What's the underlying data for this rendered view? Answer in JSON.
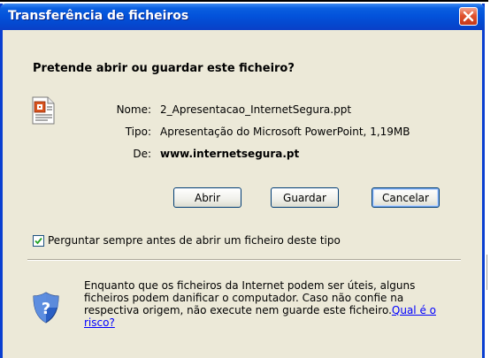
{
  "window": {
    "title": "Transferência de ficheiros",
    "close_icon": "close-icon"
  },
  "dialog": {
    "question": "Pretende abrir ou guardar este ficheiro?",
    "file_icon": "powerpoint-file-icon",
    "info": {
      "name_label": "Nome:",
      "name_value": "2_Apresentacao_InternetSegura.ppt",
      "type_label": "Tipo:",
      "type_value": "Apresentação do Microsoft PowerPoint, 1,19MB",
      "from_label": "De:",
      "from_value": "www.internetsegura.pt"
    },
    "buttons": {
      "open": "Abrir",
      "save": "Guardar",
      "cancel": "Cancelar"
    },
    "checkbox": {
      "label": "Perguntar sempre antes de abrir um ficheiro deste tipo",
      "checked": true
    },
    "warning": {
      "icon": "security-shield-icon",
      "text": "Enquanto que os ficheiros da Internet podem ser úteis, alguns ficheiros podem danificar o computador. Caso não confie na respectiva origem, não execute nem guarde este ficheiro.",
      "link": "Qual é o risco?"
    }
  },
  "colors": {
    "titlebar": "#0353db",
    "dialog_bg": "#ece9d8",
    "close_button": "#e0522f",
    "link": "#0000ff"
  }
}
